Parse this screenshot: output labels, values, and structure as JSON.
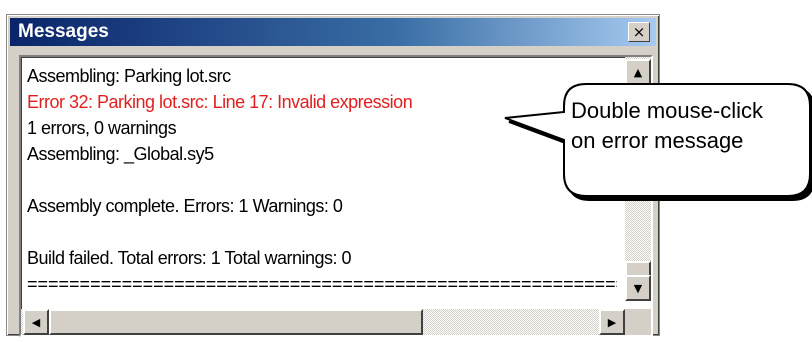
{
  "window": {
    "title": "Messages",
    "close_glyph": "×"
  },
  "messages": {
    "lines": [
      {
        "text": "Assembling: Parking lot.src",
        "kind": "normal"
      },
      {
        "text": "Error 32: Parking lot.src: Line 17: Invalid expression",
        "kind": "error"
      },
      {
        "text": "1 errors, 0 warnings",
        "kind": "normal"
      },
      {
        "text": "Assembling: _Global.sy5",
        "kind": "normal"
      },
      {
        "text": "",
        "kind": "normal"
      },
      {
        "text": "Assembly complete.  Errors: 1  Warnings: 0",
        "kind": "normal"
      },
      {
        "text": "",
        "kind": "normal"
      },
      {
        "text": "Build failed.  Total errors: 1  Total warnings: 0",
        "kind": "normal"
      },
      {
        "text": "==========================================================",
        "kind": "sep"
      }
    ],
    "error_color": "#e02020"
  },
  "scrollbars": {
    "up_glyph": "▲",
    "down_glyph": "▼",
    "left_glyph": "◀",
    "right_glyph": "▶"
  },
  "callout": {
    "line1": "Double mouse-click",
    "line2": "on error message"
  },
  "colors": {
    "titlebar_start": "#0a246a",
    "titlebar_end": "#a6caf0",
    "window_face": "#d4d0c8"
  }
}
